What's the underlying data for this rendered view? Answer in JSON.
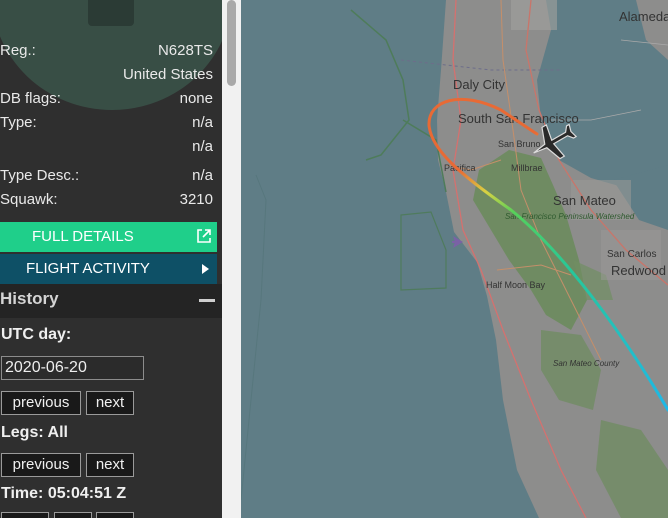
{
  "aircraft": {
    "reg_label": "Reg.:",
    "reg_value": "N628TS",
    "country": "United States",
    "db_flags_label": "DB flags:",
    "db_flags_value": "none",
    "type_label": "Type:",
    "type_value": "n/a",
    "type_value2": "n/a",
    "type_desc_label": "Type Desc.:",
    "type_desc_value": "n/a",
    "squawk_label": "Squawk:",
    "squawk_value": "3210"
  },
  "buttons": {
    "full_details": "FULL DETAILS",
    "flight_activity": "FLIGHT ACTIVITY"
  },
  "history": {
    "title": "History",
    "utc_day_label": "UTC day:",
    "utc_day_value": "2020-06-20",
    "previous": "previous",
    "next": "next",
    "legs_label": "Legs: All",
    "time_label": "Time: 05:04:51 Z"
  },
  "map": {
    "places": {
      "alameda": "Alameda",
      "daly_city": "Daly City",
      "south_sf": "South San Francisco",
      "san_bruno": "San Bruno",
      "millbrae": "Millbrae",
      "pacifica": "Pacifica",
      "san_mateo": "San Mateo",
      "san_carlos": "San Carlos",
      "redwood": "Redwood",
      "sf_watershed": "San Francisco Peninsula Watershed",
      "half_moon_bay": "Half Moon Bay",
      "san_mateo_county": "San Mateo County"
    },
    "colors": {
      "water": "#5d7d86",
      "land": "#8f8f8f",
      "park": "#6d8a5d",
      "track_start": "#22bde0",
      "track_mid": "#3fd08a",
      "track_turn": "#e0d44a",
      "track_end": "#e8703a"
    }
  }
}
